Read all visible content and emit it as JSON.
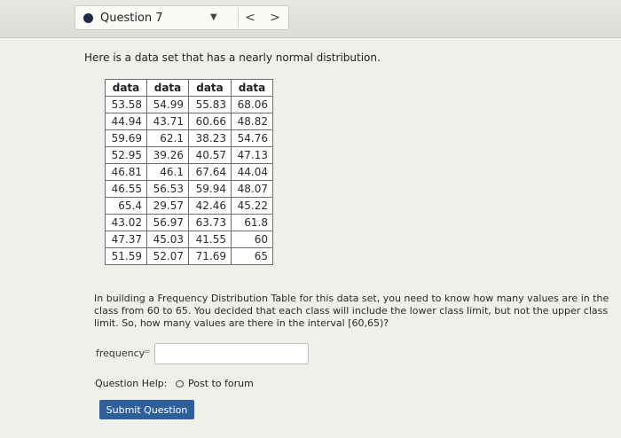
{
  "header": {
    "question_label": "Question 7",
    "dropdown_glyph": "▼",
    "prev_glyph": "<",
    "next_glyph": ">"
  },
  "intro": "Here is a data set that has a nearly normal distribution.",
  "table": {
    "headers": [
      "data",
      "data",
      "data",
      "data"
    ],
    "rows": [
      [
        "53.58",
        "54.99",
        "55.83",
        "68.06"
      ],
      [
        "44.94",
        "43.71",
        "60.66",
        "48.82"
      ],
      [
        "59.69",
        "62.1",
        "38.23",
        "54.76"
      ],
      [
        "52.95",
        "39.26",
        "40.57",
        "47.13"
      ],
      [
        "46.81",
        "46.1",
        "67.64",
        "44.04"
      ],
      [
        "46.55",
        "56.53",
        "59.94",
        "48.07"
      ],
      [
        "65.4",
        "29.57",
        "42.46",
        "45.22"
      ],
      [
        "43.02",
        "56.97",
        "63.73",
        "61.8"
      ],
      [
        "47.37",
        "45.03",
        "41.55",
        "60"
      ],
      [
        "51.59",
        "52.07",
        "71.69",
        "65"
      ]
    ]
  },
  "prompt": "In building a Frequency Distribution Table for this data set, you need to know how many values are in the class from 60 to 65. You decided that each class will include the lower class limit, but not the upper class limit. So, how many values are there in the interval [60,65)?",
  "answer": {
    "label": "frequency",
    "equals": "=",
    "value": "",
    "placeholder": ""
  },
  "help": {
    "label": "Question Help:",
    "forum_link": "Post to forum"
  },
  "submit_label": "Submit Question",
  "colors": {
    "background": "#f1efea",
    "submit_button": "#2e5f9b",
    "question_dot": "#1f2a44"
  },
  "icons": {
    "question_status": "filled-circle-icon",
    "dropdown": "caret-down-icon",
    "prev": "chevron-left-icon",
    "next": "chevron-right-icon",
    "forum": "speech-bubble-icon"
  }
}
